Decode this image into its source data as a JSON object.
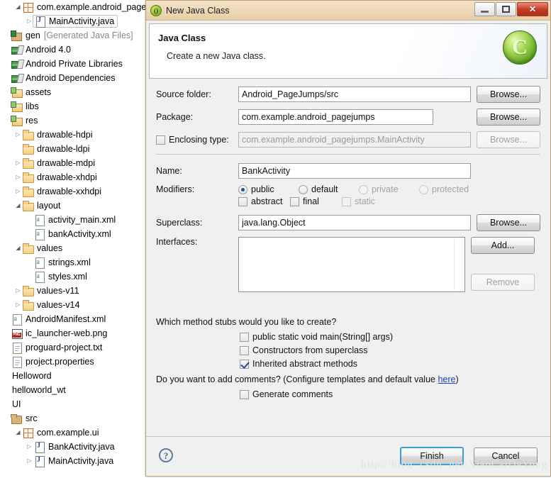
{
  "tree": {
    "items": [
      {
        "indent": 1,
        "arrow": "open",
        "icon": "ic-pkg",
        "label": "com.example.android_pagej",
        "selected": false
      },
      {
        "indent": 2,
        "arrow": "closed",
        "icon": "ic-java",
        "label": "MainActivity.java",
        "selected": true
      },
      {
        "indent": 0,
        "arrow": "none",
        "icon": "ic-genfolder",
        "label": "gen",
        "suffix": "[Generated Java Files]",
        "selected": false
      },
      {
        "indent": 0,
        "arrow": "none",
        "icon": "ic-lib",
        "label": "Android 4.0",
        "selected": false
      },
      {
        "indent": 0,
        "arrow": "none",
        "icon": "ic-lib",
        "label": "Android Private Libraries",
        "selected": false
      },
      {
        "indent": 0,
        "arrow": "none",
        "icon": "ic-lib",
        "label": "Android Dependencies",
        "selected": false
      },
      {
        "indent": 0,
        "arrow": "none",
        "icon": "ic-resfolder",
        "label": "assets",
        "selected": false
      },
      {
        "indent": 0,
        "arrow": "none",
        "icon": "ic-resfolder",
        "label": "libs",
        "selected": false
      },
      {
        "indent": 0,
        "arrow": "none",
        "icon": "ic-resfolder",
        "label": "res",
        "selected": false
      },
      {
        "indent": 1,
        "arrow": "closed",
        "icon": "ic-folder",
        "label": "drawable-hdpi",
        "selected": false
      },
      {
        "indent": 1,
        "arrow": "none",
        "icon": "ic-folder",
        "label": "drawable-ldpi",
        "selected": false
      },
      {
        "indent": 1,
        "arrow": "closed",
        "icon": "ic-folder",
        "label": "drawable-mdpi",
        "selected": false
      },
      {
        "indent": 1,
        "arrow": "closed",
        "icon": "ic-folder",
        "label": "drawable-xhdpi",
        "selected": false
      },
      {
        "indent": 1,
        "arrow": "closed",
        "icon": "ic-folder",
        "label": "drawable-xxhdpi",
        "selected": false
      },
      {
        "indent": 1,
        "arrow": "open",
        "icon": "ic-folder",
        "label": "layout",
        "selected": false
      },
      {
        "indent": 2,
        "arrow": "none",
        "icon": "ic-xml",
        "label": "activity_main.xml",
        "selected": false
      },
      {
        "indent": 2,
        "arrow": "none",
        "icon": "ic-xml",
        "label": "bankActivity.xml",
        "selected": false
      },
      {
        "indent": 1,
        "arrow": "open",
        "icon": "ic-folder",
        "label": "values",
        "selected": false
      },
      {
        "indent": 2,
        "arrow": "none",
        "icon": "ic-xml",
        "label": "strings.xml",
        "selected": false
      },
      {
        "indent": 2,
        "arrow": "none",
        "icon": "ic-xml",
        "label": "styles.xml",
        "selected": false
      },
      {
        "indent": 1,
        "arrow": "closed",
        "icon": "ic-folder",
        "label": "values-v11",
        "selected": false
      },
      {
        "indent": 1,
        "arrow": "closed",
        "icon": "ic-folder",
        "label": "values-v14",
        "selected": false
      },
      {
        "indent": 0,
        "arrow": "none",
        "icon": "ic-xml",
        "label": "AndroidManifest.xml",
        "selected": false
      },
      {
        "indent": 0,
        "arrow": "none",
        "icon": "ic-png",
        "label": "ic_launcher-web.png",
        "selected": false
      },
      {
        "indent": 0,
        "arrow": "none",
        "icon": "ic-txt",
        "label": "proguard-project.txt",
        "selected": false
      },
      {
        "indent": 0,
        "arrow": "none",
        "icon": "ic-txt",
        "label": "project.properties",
        "selected": false
      },
      {
        "indent": 0,
        "arrow": "none",
        "icon": "none",
        "label": "Helloword",
        "selected": false
      },
      {
        "indent": 0,
        "arrow": "none",
        "icon": "none",
        "label": "helloworld_wt",
        "selected": false
      },
      {
        "indent": 0,
        "arrow": "none",
        "icon": "none",
        "label": "UI",
        "selected": false
      },
      {
        "indent": 0,
        "arrow": "none",
        "icon": "ic-srcfolder",
        "label": "src",
        "selected": false
      },
      {
        "indent": 1,
        "arrow": "open",
        "icon": "ic-pkg",
        "label": "com.example.ui",
        "selected": false
      },
      {
        "indent": 2,
        "arrow": "closed",
        "icon": "ic-java",
        "label": "BankActivity.java",
        "selected": false
      },
      {
        "indent": 2,
        "arrow": "closed",
        "icon": "ic-java",
        "label": "MainActivity.java",
        "selected": false
      }
    ]
  },
  "dialog": {
    "title": "New Java Class",
    "header": {
      "title": "Java Class",
      "subtitle": "Create a new Java class."
    },
    "fields": {
      "source_folder_label": "Source folder:",
      "source_folder_value": "Android_PageJumps/src",
      "source_folder_browse": "Browse...",
      "package_label": "Package:",
      "package_value": "com.example.android_pagejumps",
      "package_browse": "Browse...",
      "enclosing_label": "Enclosing type:",
      "enclosing_value": "com.example.android_pagejumps.MainActivity",
      "enclosing_browse": "Browse...",
      "name_label": "Name:",
      "name_value": "BankActivity",
      "modifiers_label": "Modifiers:",
      "superclass_label": "Superclass:",
      "superclass_value": "java.lang.Object",
      "superclass_browse": "Browse...",
      "interfaces_label": "Interfaces:",
      "interfaces_add": "Add...",
      "interfaces_remove": "Remove"
    },
    "modifiers": {
      "radios": [
        {
          "label": "public",
          "checked": true,
          "disabled": false
        },
        {
          "label": "default",
          "checked": false,
          "disabled": false
        },
        {
          "label": "private",
          "checked": false,
          "disabled": true
        },
        {
          "label": "protected",
          "checked": false,
          "disabled": true
        }
      ],
      "checks": [
        {
          "label": "abstract",
          "checked": false,
          "disabled": false
        },
        {
          "label": "final",
          "checked": false,
          "disabled": false
        },
        {
          "label": "static",
          "checked": false,
          "disabled": true
        }
      ]
    },
    "stubs": {
      "question": "Which method stubs would you like to create?",
      "options": [
        {
          "label": "public static void main(String[] args)",
          "checked": false
        },
        {
          "label": "Constructors from superclass",
          "checked": false
        },
        {
          "label": "Inherited abstract methods",
          "checked": true
        }
      ]
    },
    "comments": {
      "question_prefix": "Do you want to add comments? (Configure templates and default value ",
      "link": "here",
      "question_suffix": ")",
      "option": {
        "label": "Generate comments",
        "checked": false
      }
    },
    "footer": {
      "help": "?",
      "finish": "Finish",
      "cancel": "Cancel"
    },
    "window_controls": {
      "minimize": "minimize-icon",
      "maximize": "restore-icon",
      "close": "✕"
    }
  },
  "watermark": "http://blog. csdn. net/XiaoCaiDaYong"
}
